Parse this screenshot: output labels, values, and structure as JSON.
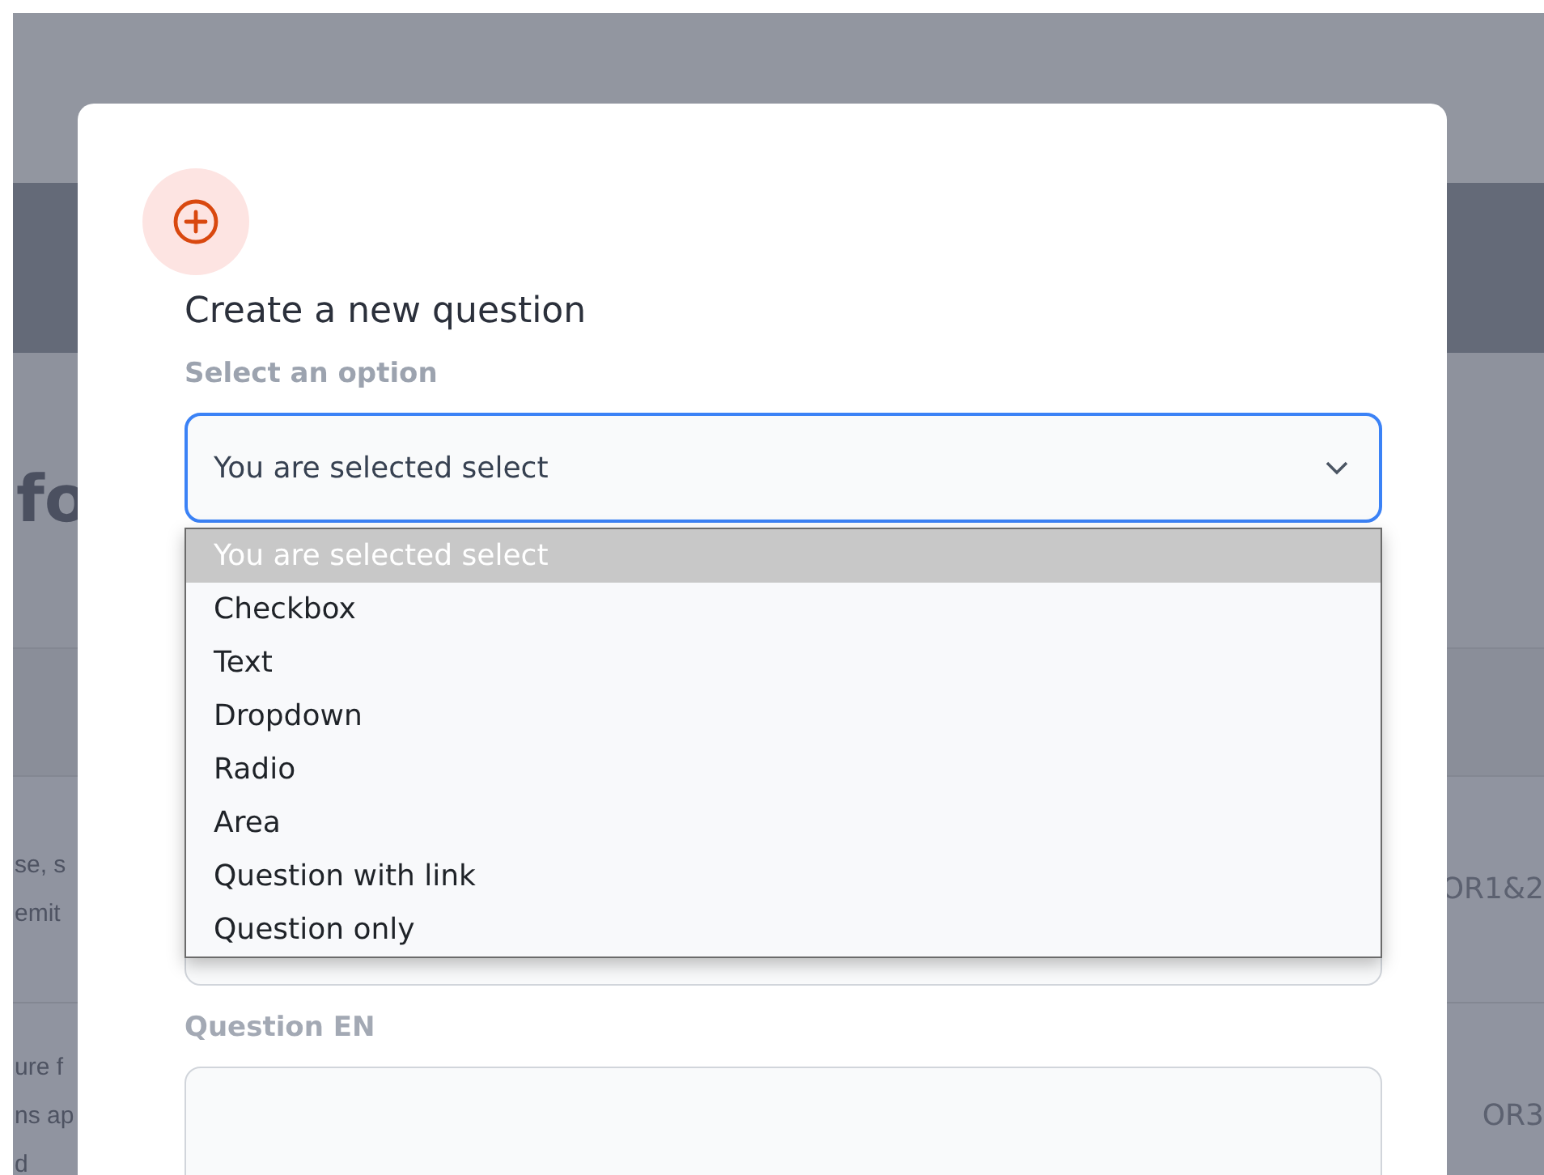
{
  "background": {
    "heading": "fo",
    "rows": [
      {
        "left": [
          "se, s",
          "emit"
        ],
        "right": "OR1&2"
      },
      {
        "left": [
          "ure f",
          "ns ap",
          "d"
        ],
        "right": "OR3"
      }
    ]
  },
  "modal": {
    "title": "Create a new question",
    "select_label": "Select an option",
    "select": {
      "value": "You are selected select",
      "expanded": true
    },
    "options": [
      {
        "label": "You are selected select",
        "selected": true
      },
      {
        "label": "Checkbox",
        "selected": false
      },
      {
        "label": "Text",
        "selected": false
      },
      {
        "label": "Dropdown",
        "selected": false
      },
      {
        "label": "Radio",
        "selected": false
      },
      {
        "label": "Area",
        "selected": false
      },
      {
        "label": "Question with link",
        "selected": false
      },
      {
        "label": "Question only",
        "selected": false
      }
    ],
    "question_label": "Question EN"
  }
}
